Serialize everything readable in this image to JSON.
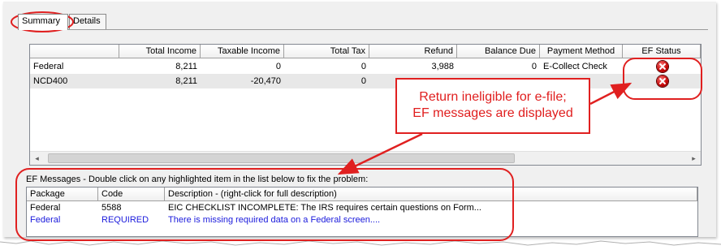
{
  "tabs": [
    {
      "label": "Summary",
      "active": true
    },
    {
      "label": "Details",
      "active": false
    }
  ],
  "summary_grid": {
    "columns": [
      "",
      "Total Income",
      "Taxable Income",
      "Total Tax",
      "Refund",
      "Balance Due",
      "Payment Method",
      "EF Status"
    ],
    "rows": [
      {
        "return": "Federal",
        "total_income": "8,211",
        "taxable_income": "0",
        "total_tax": "0",
        "refund": "3,988",
        "balance_due": "0",
        "payment_method": "E-Collect Check",
        "ef_status_icon": "error-x-icon"
      },
      {
        "return": "NCD400",
        "total_income": "8,211",
        "taxable_income": "-20,470",
        "total_tax": "0",
        "refund": "",
        "balance_due": "",
        "payment_method": "",
        "ef_status_icon": "error-x-icon"
      }
    ]
  },
  "scrollbar": {
    "left_arrow": "◂",
    "right_arrow": "▸"
  },
  "ef_messages": {
    "caption": "EF Messages - Double click on any highlighted item in the list below to fix the problem:",
    "columns": [
      "Package",
      "Code",
      "Description - (right-click for full description)"
    ],
    "rows": [
      {
        "package": "Federal",
        "code": "5588",
        "description": "EIC CHECKLIST INCOMPLETE: The IRS requires certain questions on Form...",
        "highlighted": false
      },
      {
        "package": "Federal",
        "code": "REQUIRED",
        "description": "There is missing required data on a Federal screen....",
        "highlighted": true
      }
    ]
  },
  "annotation": {
    "line1": "Return ineligible for e-file;",
    "line2": "EF messages are displayed",
    "color": "#e02020"
  },
  "colors": {
    "required_text": "#1a1adc",
    "error_icon": "#c00000"
  }
}
